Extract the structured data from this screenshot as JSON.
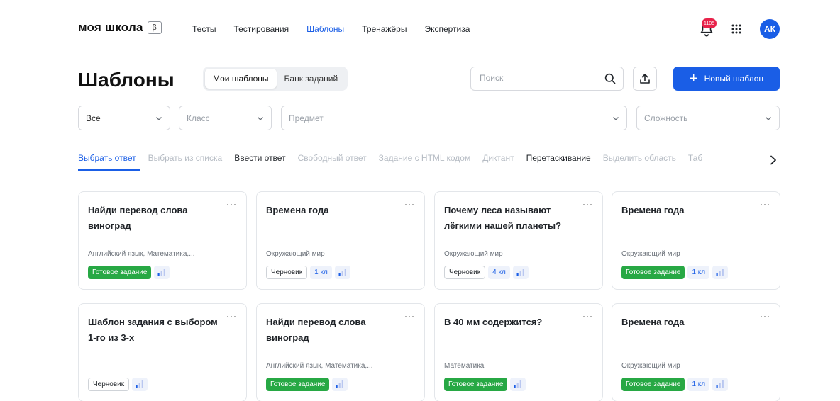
{
  "header": {
    "logo": "моя школа",
    "beta": "β",
    "nav": [
      "Тесты",
      "Тестирования",
      "Шаблоны",
      "Тренажёры",
      "Экспертиза"
    ],
    "active_nav_index": 2,
    "notifications_count": "1105",
    "avatar_initials": "АК"
  },
  "page": {
    "title": "Шаблоны",
    "segments": [
      "Мои шаблоны",
      "Банк заданий"
    ],
    "active_segment": 0,
    "search_placeholder": "Поиск",
    "new_button": "Новый шаблон"
  },
  "filters": {
    "type_value": "Все",
    "class_placeholder": "Класс",
    "subject_placeholder": "Предмет",
    "difficulty_placeholder": "Сложность"
  },
  "tabs": [
    {
      "label": "Выбрать ответ",
      "state": "active"
    },
    {
      "label": "Выбрать из списка",
      "state": "muted"
    },
    {
      "label": "Ввести ответ",
      "state": "dark"
    },
    {
      "label": "Свободный ответ",
      "state": "muted"
    },
    {
      "label": "Задание с HTML кодом",
      "state": "muted"
    },
    {
      "label": "Диктант",
      "state": "muted"
    },
    {
      "label": "Перетаскивание",
      "state": "dark"
    },
    {
      "label": "Выделить область",
      "state": "muted"
    },
    {
      "label": "Таб",
      "state": "muted"
    }
  ],
  "cards": [
    {
      "title": "Найди перевод слова виноград",
      "subject": "Английский язык, Математика,...",
      "status": "Готовое задание",
      "status_type": "ready",
      "grade": ""
    },
    {
      "title": "Времена года",
      "subject": "Окружающий мир",
      "status": "Черновик",
      "status_type": "draft",
      "grade": "1 кл"
    },
    {
      "title": "Почему леса называют лёгкими нашей планеты?",
      "subject": "Окружающий мир",
      "status": "Черновик",
      "status_type": "draft",
      "grade": "4 кл"
    },
    {
      "title": "Времена года",
      "subject": "Окружающий мир",
      "status": "Готовое задание",
      "status_type": "ready",
      "grade": "1 кл"
    },
    {
      "title": "Шаблон задания с выбором 1-го из 3-х",
      "subject": "",
      "status": "Черновик",
      "status_type": "draft",
      "grade": ""
    },
    {
      "title": "Найди перевод слова виноград",
      "subject": "Английский язык, Математика,...",
      "status": "Готовое задание",
      "status_type": "ready",
      "grade": ""
    },
    {
      "title": "В 40 мм содержится?",
      "subject": "Математика",
      "status": "Готовое задание",
      "status_type": "ready",
      "grade": ""
    },
    {
      "title": "Времена года",
      "subject": "Окружающий мир",
      "status": "Готовое задание",
      "status_type": "ready",
      "grade": "1 кл"
    }
  ],
  "colors": {
    "accent": "#1a5ee6",
    "ready": "#27a844",
    "badge": "#e8224a",
    "level_bar_active": "#1a5ee6",
    "level_bar_inactive": "#b9c7f0"
  },
  "icons": {
    "bell": "bell-icon",
    "apps": "apps-grid-icon",
    "search": "search-icon",
    "upload": "upload-icon",
    "chevron": "chevron-down-icon",
    "next": "chevron-right-icon",
    "level": "difficulty-bars-icon",
    "menu": "more-dots-icon"
  }
}
